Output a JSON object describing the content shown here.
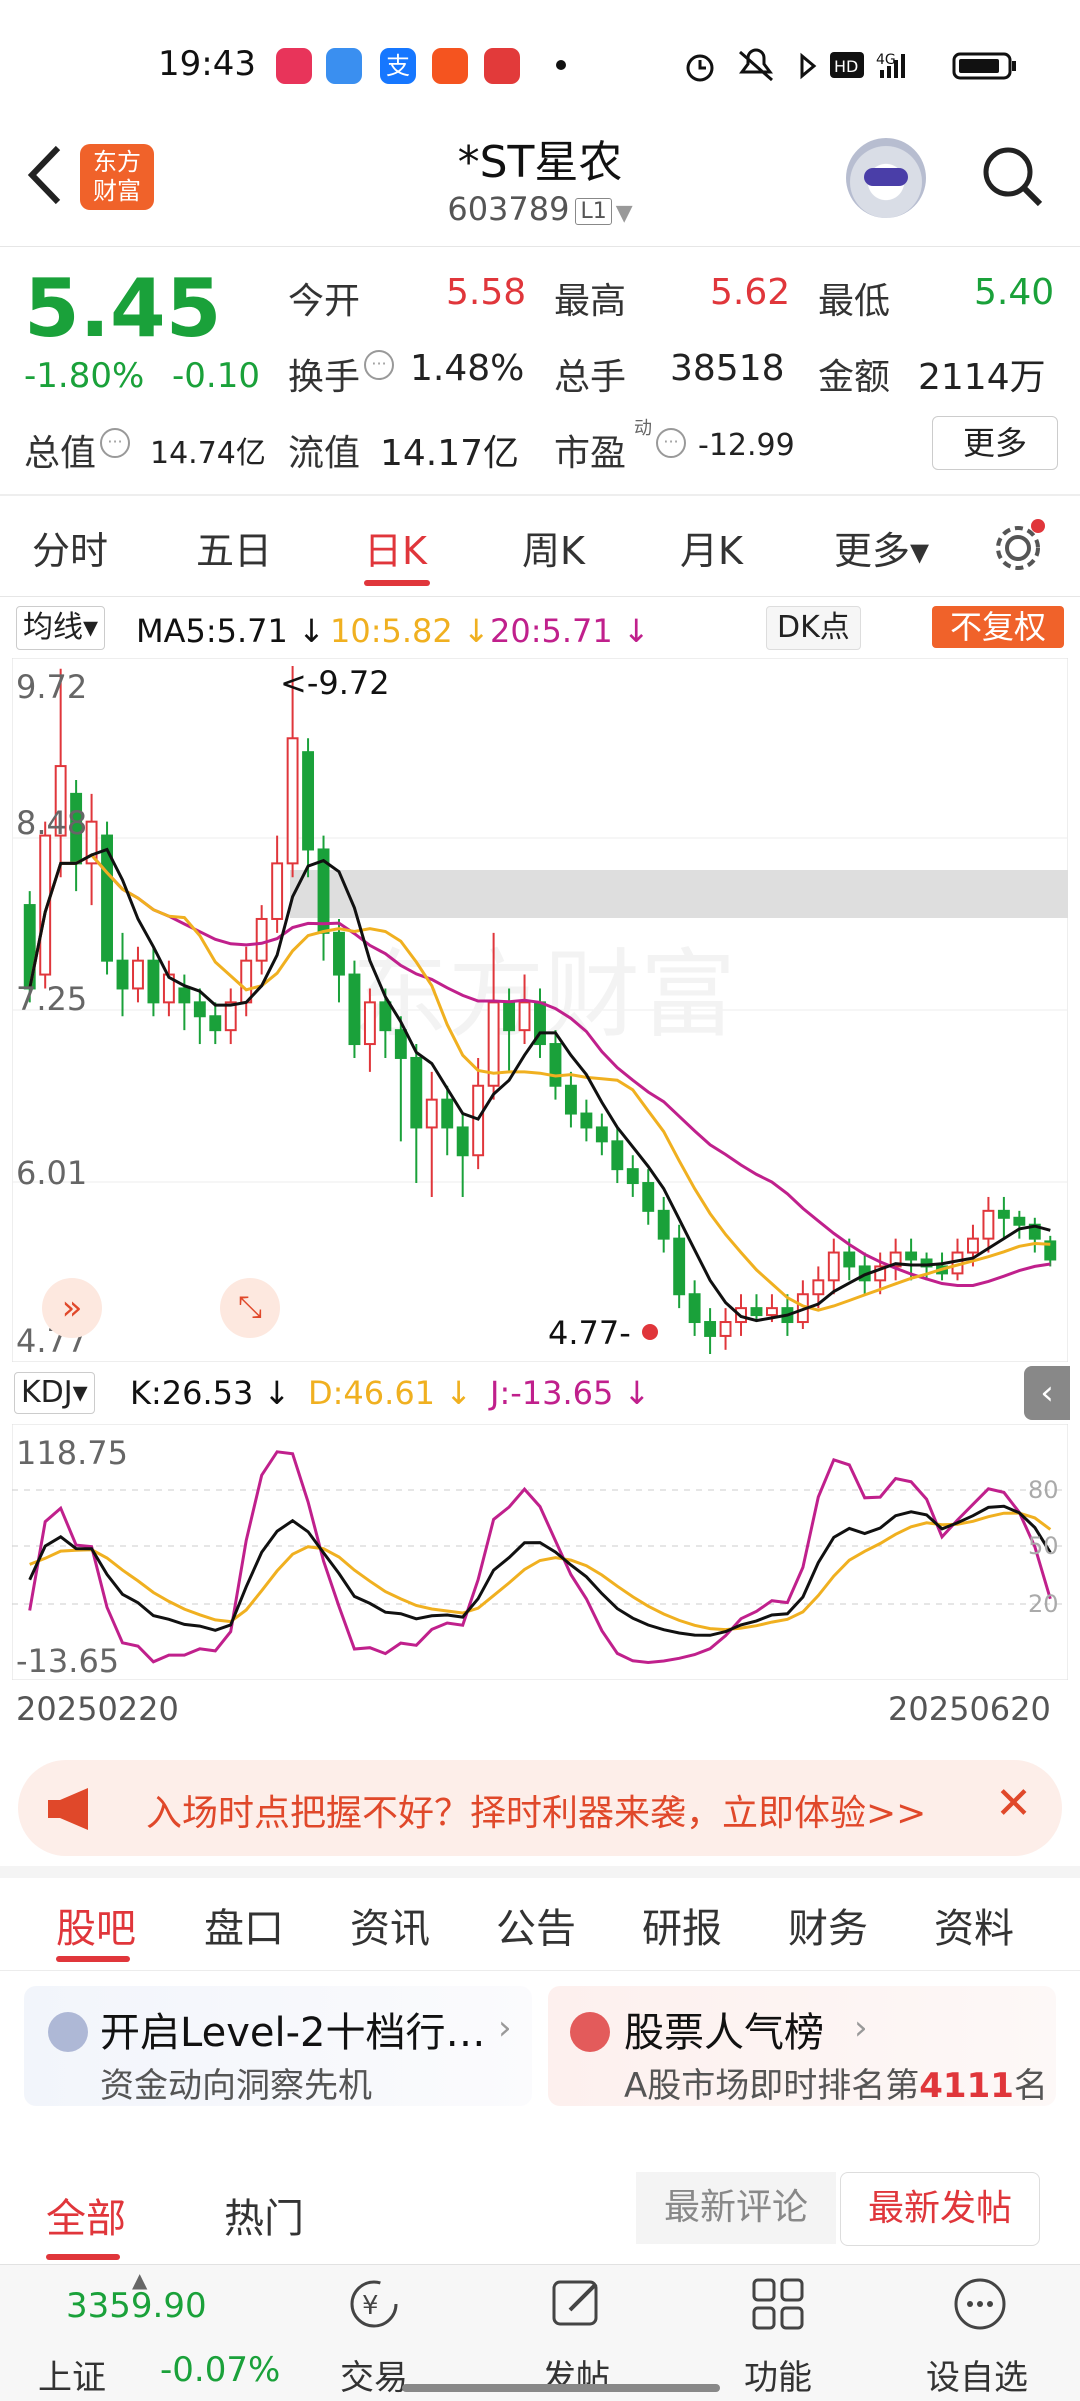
{
  "status_bar": {
    "time": "19:43",
    "icons": [
      "alarm-icon",
      "mute-icon",
      "bluetooth-icon",
      "hd-icon",
      "signal-4g-icon",
      "battery-icon"
    ]
  },
  "header": {
    "name": "*ST星农",
    "code": "603789",
    "level": "L1",
    "logo_line1": "东方",
    "logo_line2": "财富"
  },
  "quote": {
    "price": "5.45",
    "change_pct": "-1.80%",
    "change_abs": "-0.10",
    "open_label": "今开",
    "open": "5.58",
    "high_label": "最高",
    "high": "5.62",
    "low_label": "最低",
    "low": "5.40",
    "turnover_label": "换手",
    "turnover": "1.48%",
    "volume_label": "总手",
    "volume": "38518",
    "amount_label": "金额",
    "amount": "2114万",
    "mktcap_label": "总值",
    "mktcap": "14.74亿",
    "float_label": "流值",
    "float": "14.17亿",
    "pe_label": "市盈",
    "pe_sup": "动",
    "pe": "-12.99",
    "more": "更多"
  },
  "period_tabs": [
    "分时",
    "五日",
    "日K",
    "周K",
    "月K",
    "更多▾"
  ],
  "active_period": 2,
  "ma_bar": {
    "selector": "均线▾",
    "ma5": "MA5:5.71",
    "ma10": "10:5.82",
    "ma20": "20:5.71",
    "dk": "DK点",
    "adjust": "不复权",
    "arrow": "↓"
  },
  "kline_axis": {
    "top": "9.72",
    "l2": "8.48",
    "l3": "7.25",
    "l4": "6.01",
    "bottom": "4.77",
    "max_label": "<-9.72",
    "min_label": "4.77-"
  },
  "watermark": "东方财富",
  "kdj_bar": {
    "selector": "KDJ▾",
    "k": "K:26.53",
    "d": "D:46.61",
    "j": "J:-13.65",
    "arrow": "↓"
  },
  "kdj_axis": {
    "top": "118.75",
    "bottom": "-13.65",
    "r80": "80",
    "r50": "50",
    "r20": "20"
  },
  "dates": {
    "start": "20250220",
    "end": "20250620"
  },
  "promo": {
    "text": "入场时点把握不好？择时利器来袭，立即体验>>",
    "close": "✕"
  },
  "section_tabs": [
    "股吧",
    "盘口",
    "资讯",
    "公告",
    "研报",
    "财务",
    "资料"
  ],
  "cards": {
    "left_title": "开启Level-2十档行…",
    "left_sub": "资金动向洞察先机",
    "right_title": "股票人气榜",
    "right_sub_pre": "A股市场即时排名第",
    "right_rank": "4111",
    "right_sub_post": "名"
  },
  "feed_tabs": {
    "all": "全部",
    "hot": "热门",
    "newest_comment": "最新评论",
    "newest_post": "最新发帖"
  },
  "bottom_nav": {
    "index_value": "3359.90",
    "index_name": "上证",
    "index_change": "-0.07%",
    "trade": "交易",
    "post": "发帖",
    "func": "功能",
    "watch": "设自选"
  },
  "chart_data": {
    "type": "candlestick",
    "x_range": [
      "20250220",
      "20250620"
    ],
    "ylim": [
      4.77,
      9.72
    ],
    "candles_approx": [
      [
        8.0,
        7.4,
        8.1,
        7.3
      ],
      [
        7.5,
        8.5,
        8.6,
        7.4
      ],
      [
        8.5,
        9.0,
        9.7,
        8.2
      ],
      [
        8.8,
        8.3,
        8.9,
        8.1
      ],
      [
        8.3,
        8.6,
        8.8,
        8.0
      ],
      [
        8.5,
        7.6,
        8.6,
        7.5
      ],
      [
        7.6,
        7.4,
        7.8,
        7.2
      ],
      [
        7.4,
        7.6,
        7.7,
        7.3
      ],
      [
        7.6,
        7.3,
        7.7,
        7.2
      ],
      [
        7.3,
        7.5,
        7.6,
        7.2
      ],
      [
        7.4,
        7.3,
        7.5,
        7.1
      ],
      [
        7.3,
        7.2,
        7.4,
        7.0
      ],
      [
        7.2,
        7.1,
        7.3,
        7.0
      ],
      [
        7.1,
        7.3,
        7.4,
        7.0
      ],
      [
        7.3,
        7.6,
        7.7,
        7.2
      ],
      [
        7.6,
        7.9,
        8.0,
        7.5
      ],
      [
        7.9,
        8.3,
        8.5,
        7.8
      ],
      [
        8.3,
        9.2,
        9.72,
        8.2
      ],
      [
        9.1,
        8.4,
        9.2,
        8.2
      ],
      [
        8.4,
        7.8,
        8.5,
        7.6
      ],
      [
        7.8,
        7.5,
        7.9,
        7.3
      ],
      [
        7.5,
        7.0,
        7.6,
        6.9
      ],
      [
        7.0,
        7.3,
        7.4,
        6.8
      ],
      [
        7.3,
        7.1,
        7.4,
        6.9
      ],
      [
        7.1,
        6.9,
        7.2,
        6.3
      ],
      [
        6.9,
        6.4,
        7.0,
        6.0
      ],
      [
        6.4,
        6.6,
        6.8,
        5.9
      ],
      [
        6.6,
        6.4,
        6.7,
        6.2
      ],
      [
        6.4,
        6.2,
        6.5,
        5.9
      ],
      [
        6.2,
        6.7,
        6.9,
        6.1
      ],
      [
        6.7,
        7.3,
        7.8,
        6.6
      ],
      [
        7.3,
        7.1,
        7.4,
        6.8
      ],
      [
        7.1,
        7.3,
        7.5,
        7.0
      ],
      [
        7.3,
        7.0,
        7.4,
        6.9
      ],
      [
        7.0,
        6.7,
        7.1,
        6.6
      ],
      [
        6.7,
        6.5,
        6.8,
        6.4
      ],
      [
        6.5,
        6.4,
        6.6,
        6.3
      ],
      [
        6.4,
        6.3,
        6.5,
        6.2
      ],
      [
        6.3,
        6.1,
        6.4,
        6.0
      ],
      [
        6.1,
        6.0,
        6.2,
        5.9
      ],
      [
        6.0,
        5.8,
        6.1,
        5.7
      ],
      [
        5.8,
        5.6,
        5.9,
        5.5
      ],
      [
        5.6,
        5.2,
        5.7,
        5.1
      ],
      [
        5.2,
        5.0,
        5.3,
        4.9
      ],
      [
        5.0,
        4.9,
        5.1,
        4.77
      ],
      [
        4.9,
        5.0,
        5.1,
        4.8
      ],
      [
        5.0,
        5.1,
        5.2,
        4.9
      ],
      [
        5.1,
        5.05,
        5.2,
        5.0
      ],
      [
        5.05,
        5.1,
        5.2,
        5.0
      ],
      [
        5.1,
        5.0,
        5.2,
        4.9
      ],
      [
        5.0,
        5.2,
        5.3,
        4.95
      ],
      [
        5.2,
        5.3,
        5.4,
        5.1
      ],
      [
        5.3,
        5.5,
        5.6,
        5.2
      ],
      [
        5.5,
        5.4,
        5.6,
        5.3
      ],
      [
        5.4,
        5.3,
        5.5,
        5.2
      ],
      [
        5.3,
        5.4,
        5.5,
        5.2
      ],
      [
        5.4,
        5.5,
        5.6,
        5.3
      ],
      [
        5.5,
        5.45,
        5.6,
        5.3
      ],
      [
        5.45,
        5.4,
        5.5,
        5.3
      ],
      [
        5.4,
        5.35,
        5.5,
        5.3
      ],
      [
        5.35,
        5.5,
        5.6,
        5.3
      ],
      [
        5.5,
        5.6,
        5.7,
        5.4
      ],
      [
        5.6,
        5.8,
        5.9,
        5.5
      ],
      [
        5.8,
        5.75,
        5.9,
        5.6
      ],
      [
        5.75,
        5.7,
        5.8,
        5.6
      ],
      [
        5.7,
        5.6,
        5.75,
        5.5
      ],
      [
        5.58,
        5.45,
        5.62,
        5.4
      ]
    ],
    "series": [
      {
        "name": "MA5",
        "value": "5.71",
        "color": "#111111"
      },
      {
        "name": "MA10",
        "value": "5.82",
        "color": "#f0b020"
      },
      {
        "name": "MA20",
        "value": "5.71",
        "color": "#c0208c"
      }
    ]
  },
  "colors": {
    "up": "#e0363b",
    "down": "#1aa13a",
    "brand": "#f0622a",
    "ma5": "#111111",
    "ma10": "#f0b020",
    "ma20": "#c0208c"
  }
}
